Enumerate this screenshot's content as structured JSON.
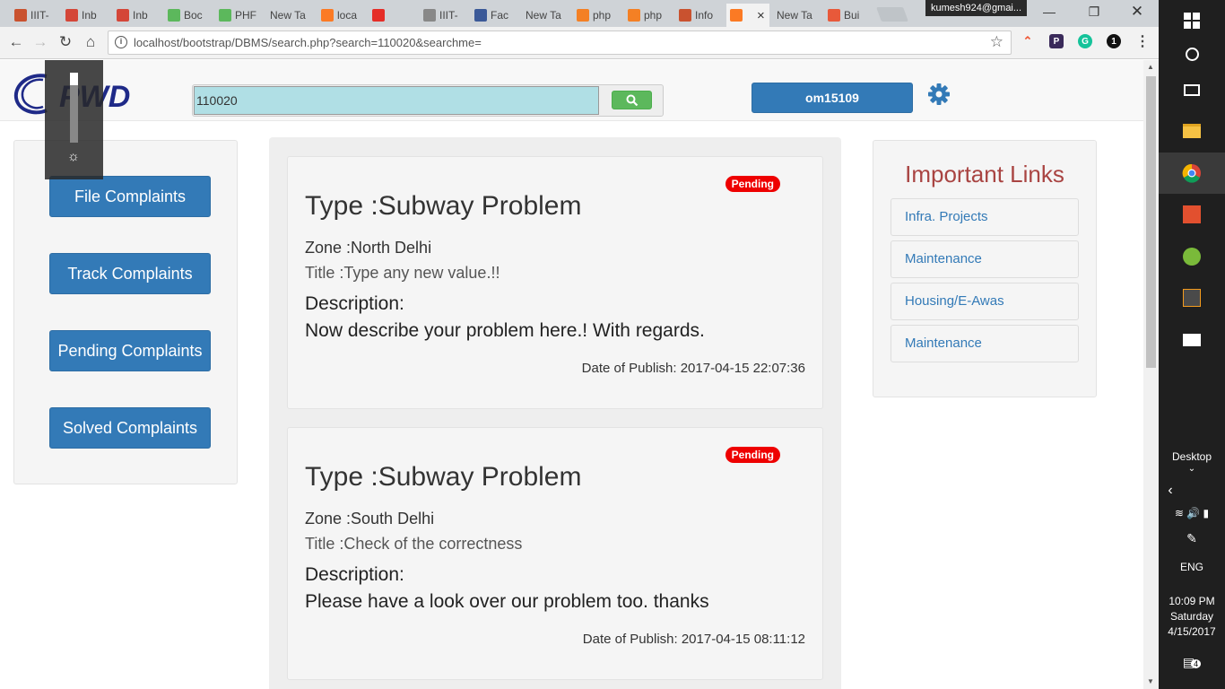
{
  "browser": {
    "tabs": [
      {
        "label": "IIIT-",
        "favicon": "bookpack-icon",
        "color": "#c9522f"
      },
      {
        "label": "Inb",
        "favicon": "gmail-icon",
        "color": "#d44638"
      },
      {
        "label": "Inb",
        "favicon": "gmail-icon",
        "color": "#d44638"
      },
      {
        "label": "Boc",
        "favicon": "codechef-icon",
        "color": "#5cb85c"
      },
      {
        "label": "PHF",
        "favicon": "codechef-icon",
        "color": "#5cb85c"
      },
      {
        "label": "New Ta",
        "favicon": "",
        "color": ""
      },
      {
        "label": "loca",
        "favicon": "xampp-icon",
        "color": "#fb7a24"
      },
      {
        "label": "",
        "favicon": "youtube-icon",
        "color": "#e52d27"
      },
      {
        "label": "IIIT-",
        "favicon": "document-icon",
        "color": "#888888"
      },
      {
        "label": "Fac",
        "favicon": "facebook-icon",
        "color": "#3b5998"
      },
      {
        "label": "New Ta",
        "favicon": "",
        "color": ""
      },
      {
        "label": "php",
        "favicon": "stackoverflow-icon",
        "color": "#f48024"
      },
      {
        "label": "php",
        "favicon": "stackoverflow-icon",
        "color": "#f48024"
      },
      {
        "label": "Info",
        "favicon": "bookpack-icon",
        "color": "#c9522f"
      },
      {
        "label": "",
        "favicon": "xampp-icon",
        "color": "#fb7a24",
        "active": true
      },
      {
        "label": "New Ta",
        "favicon": "",
        "color": ""
      },
      {
        "label": "Bui",
        "favicon": "plus-icon",
        "color": "#e8593a"
      }
    ],
    "profile": "kumesh924@gmai...",
    "url": "localhost/bootstrap/DBMS/search.php?search=110020&searchme="
  },
  "header": {
    "logo_text": "PWD",
    "search_value": "110020",
    "user_label": "om15109"
  },
  "sidebar": {
    "buttons": [
      "File Complaints",
      "Track Complaints",
      "Pending Complaints",
      "Solved Complaints"
    ]
  },
  "complaints": [
    {
      "status": "Pending",
      "type": "Type :Subway Problem",
      "zone": "Zone :North Delhi",
      "title": "Title :Type any new value.!!",
      "desc_heading": "Description:",
      "description": "Now describe your problem here.! With regards.",
      "date": "Date of Publish: 2017-04-15 22:07:36"
    },
    {
      "status": "Pending",
      "type": "Type :Subway Problem",
      "zone": "Zone :South Delhi",
      "title": "Title :Check of the correctness",
      "desc_heading": "Description:",
      "description": "Please have a look over our problem too. thanks",
      "date": "Date of Publish: 2017-04-15 08:11:12"
    }
  ],
  "important_links": {
    "title": "Important Links",
    "links": [
      "Infra. Projects",
      "Maintenance",
      "Housing/E-Awas",
      "Maintenance"
    ]
  },
  "taskbar": {
    "desktop_label": "Desktop",
    "language": "ENG",
    "time": "10:09 PM",
    "day": "Saturday",
    "date": "4/15/2017",
    "notification_count": "4"
  },
  "colors": {
    "primary": "#337ab7",
    "success": "#5cb85c",
    "danger": "#ee0000",
    "heading_red": "#a94442",
    "search_bg": "#b0dfe5"
  }
}
